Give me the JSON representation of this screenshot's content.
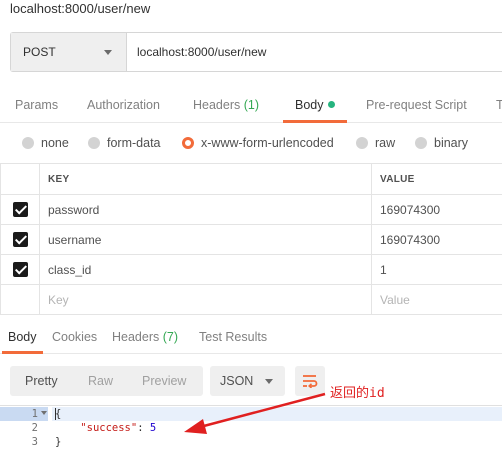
{
  "window_title": "localhost:8000/user/new",
  "request": {
    "method": "POST",
    "url": "localhost:8000/user/new"
  },
  "request_tabs": [
    {
      "label": "Params"
    },
    {
      "label": "Authorization"
    },
    {
      "label": "Headers",
      "count": "(1)"
    },
    {
      "label": "Body"
    },
    {
      "label": "Pre-request Script"
    },
    {
      "label": "T"
    }
  ],
  "body_types": [
    "none",
    "form-data",
    "x-www-form-urlencoded",
    "raw",
    "binary"
  ],
  "body_type_selected": "x-www-form-urlencoded",
  "params_table": {
    "headers": {
      "key": "KEY",
      "value": "VALUE"
    },
    "rows": [
      {
        "key": "password",
        "value": "169074300",
        "checked": true
      },
      {
        "key": "username",
        "value": "169074300",
        "checked": true
      },
      {
        "key": "class_id",
        "value": "1",
        "checked": true
      }
    ],
    "placeholder": {
      "key": "Key",
      "value": "Value"
    }
  },
  "response_tabs": [
    {
      "label": "Body"
    },
    {
      "label": "Cookies"
    },
    {
      "label": "Headers",
      "count": "(7)"
    },
    {
      "label": "Test Results"
    }
  ],
  "response_toolbar": {
    "views": [
      "Pretty",
      "Raw",
      "Preview"
    ],
    "active_view": "Pretty",
    "format": "JSON",
    "wrap_icon": "wrap-lines-icon"
  },
  "code": {
    "line_numbers": [
      "1",
      "2",
      "3"
    ],
    "line1": "{",
    "key": "\"success\"",
    "colon": ": ",
    "value": "5",
    "line3": "}"
  },
  "annotation": {
    "text": "返回的id",
    "color": "#e02020"
  },
  "colors": {
    "accent": "#f26b3a",
    "body_dot": "#26b47f",
    "count": "#34a853"
  }
}
